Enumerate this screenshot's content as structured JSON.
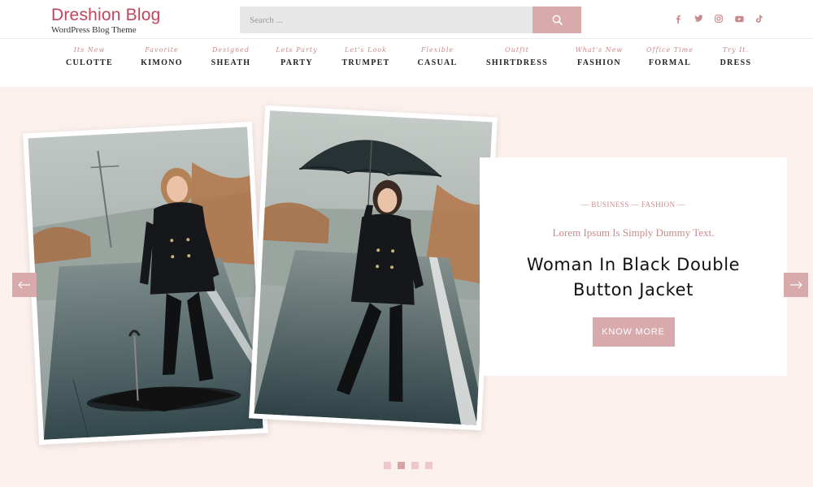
{
  "brand": {
    "title": "Dreshion Blog",
    "tagline": "WordPress Blog Theme"
  },
  "search": {
    "placeholder": "Search ...",
    "icon": "search-icon"
  },
  "socials": [
    {
      "name": "facebook-icon"
    },
    {
      "name": "twitter-icon"
    },
    {
      "name": "instagram-icon"
    },
    {
      "name": "youtube-icon"
    },
    {
      "name": "tiktok-icon"
    }
  ],
  "menu": [
    {
      "sub": "Its New",
      "label": "CULOTTE"
    },
    {
      "sub": "Favorite",
      "label": "KIMONO"
    },
    {
      "sub": "Designed",
      "label": "SHEATH"
    },
    {
      "sub": "Lets Party",
      "label": "PARTY"
    },
    {
      "sub": "Let's Look",
      "label": "TRUMPET"
    },
    {
      "sub": "Flexible",
      "label": "CASUAL"
    },
    {
      "sub": "Outfit",
      "label": "SHIRTDRESS"
    },
    {
      "sub": "What's New",
      "label": "FASHION"
    },
    {
      "sub": "Office Time",
      "label": "FORMAL"
    },
    {
      "sub": "Try It.",
      "label": "DRESS"
    }
  ],
  "slide": {
    "categories": "— BUSINESS — FASHION —",
    "subtitle": "Lorem Ipsum Is Simply Dummy Text.",
    "title": "Woman In Black Double Button Jacket",
    "button": "KNOW MORE"
  },
  "slider": {
    "slide_count": 4,
    "active_index": 1
  },
  "colors": {
    "brand": "#c0455d",
    "accent": "#d8aaac",
    "hero_bg": "#fcf0ed",
    "menu_sub": "#c98a8d"
  }
}
